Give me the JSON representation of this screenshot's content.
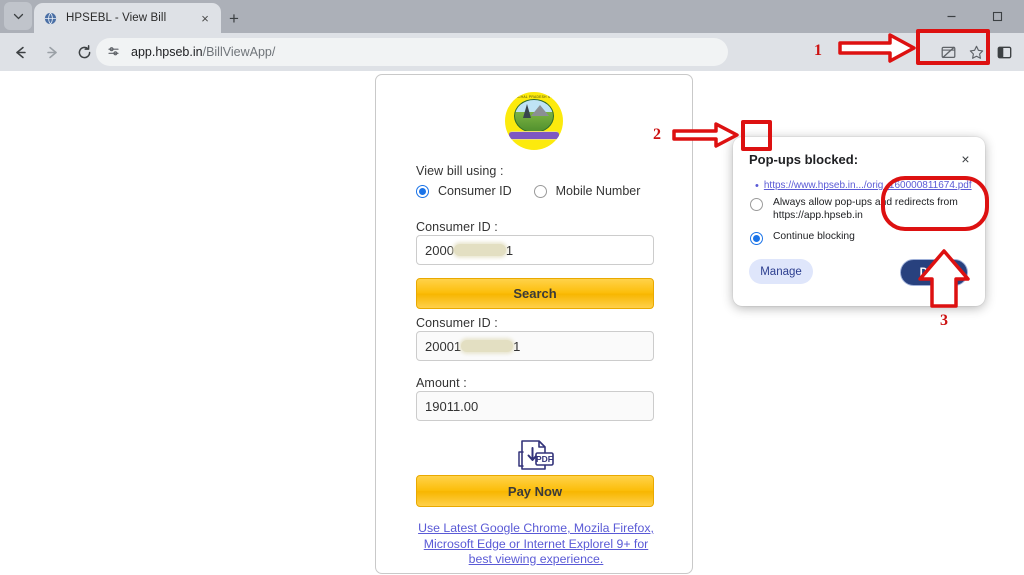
{
  "browser": {
    "tab": {
      "title": "HPSEBL - View Bill",
      "close_label": "×",
      "favicon": "globe-icon"
    },
    "new_tab_label": "+",
    "tab_search_icon": "chevron-down-icon",
    "window_controls": {
      "minimize": "–"
    },
    "omnibox": {
      "url_host": "app.hpseb.in",
      "url_path": "/BillViewApp/",
      "tune_icon": "site-settings-icon"
    },
    "toolbar_icons": {
      "popup_blocked": "popup-blocked-icon",
      "bookmark": "star-icon",
      "side_panel": "side-panel-icon"
    }
  },
  "page": {
    "logo_alt": "HPSEBL emblem",
    "logo_arc_text": "HIMACHAL PRADESH STATE",
    "view_bill_label": "View bill using :",
    "options": [
      {
        "label": "Consumer ID",
        "selected": true
      },
      {
        "label": "Mobile Number",
        "selected": false
      }
    ],
    "consumer_id_label_1": "Consumer ID :",
    "consumer_id_value_1_prefix": "2000",
    "consumer_id_value_1_suffix": "1",
    "search_button": "Search",
    "consumer_id_label_2": "Consumer ID :",
    "consumer_id_value_2_prefix": "20001",
    "consumer_id_value_2_suffix": "1",
    "amount_label": "Amount :",
    "amount_value": "19011.00",
    "pdf_icon_label": "PDF",
    "pay_now_button": "Pay Now",
    "footer_note": "Use Latest Google Chrome, Mozila Firefox, Microsoft Edge or Internet Explorel 9+ for best viewing experience."
  },
  "popup": {
    "title": "Pop-ups blocked:",
    "close_label": "×",
    "blocked_link": "https://www.hpseb.in.../orig_160000811674.pdf",
    "options": [
      {
        "label": "Always allow pop-ups and redirects from https://app.hpseb.in",
        "selected": false
      },
      {
        "label": "Continue blocking",
        "selected": true
      }
    ],
    "manage_button": "Manage",
    "done_button": "Done"
  },
  "annotations": [
    {
      "number": "1",
      "target": "popup-blocked-toolbar-icon"
    },
    {
      "number": "2",
      "target": "always-allow-radio"
    },
    {
      "number": "3",
      "target": "done-button"
    }
  ],
  "colors": {
    "annotation_red": "#dd1111",
    "brand_yellow": "#fcbe0a",
    "link_blue": "#5a5ad6",
    "done_blue": "#28417e",
    "radio_blue": "#1a73e8"
  }
}
